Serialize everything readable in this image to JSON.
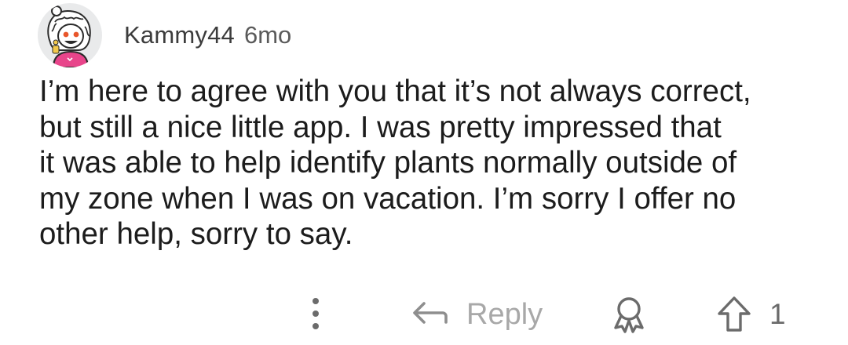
{
  "comment": {
    "author": "Kammy44",
    "age": "6mo",
    "body": "I’m here to agree with you that it’s not always correct,\nbut still a nice little app. I was pretty impressed that\nit was able to help identify plants normally outside of\nmy zone when I was on vacation. I’m sorry I offer no\nother help, sorry to say.",
    "actions": {
      "more_icon": "vertical-dots-icon",
      "reply_icon": "reply-arrow-icon",
      "reply_label": "Reply",
      "award_icon": "award-icon",
      "upvote_icon": "upvote-arrow-icon",
      "vote_count": "1"
    }
  },
  "colors": {
    "avatar_background": "#e9eaeb",
    "avatar_shirt": "#e8458b",
    "muted_text": "#a8a8a8",
    "body_text": "#1c1c1c"
  }
}
